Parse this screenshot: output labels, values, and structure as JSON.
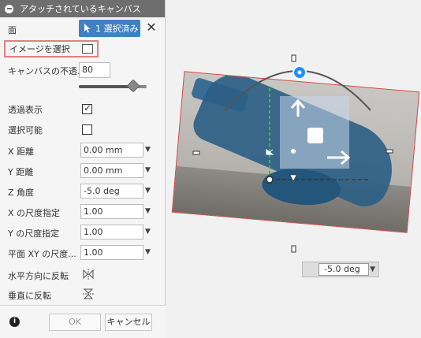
{
  "panel": {
    "title": "アタッチされているキャンバス",
    "face_label": "面",
    "selected_button_label": "1 選択済み",
    "clear_label": "✕",
    "select_image_label": "イメージを選択",
    "opacity_label": "キャンバスの不透...",
    "opacity_value": "80",
    "opacity_fraction": 0.8,
    "see_through_label": "透過表示",
    "see_through_checked": true,
    "selectable_label": "選択可能",
    "selectable_checked": false,
    "x_distance_label": "X 距離",
    "x_distance_value": "0.00 mm",
    "y_distance_label": "Y 距離",
    "y_distance_value": "0.00 mm",
    "z_angle_label": "Z 角度",
    "z_angle_value": "-5.0 deg",
    "x_scale_label": "X の尺度指定",
    "x_scale_value": "1.00",
    "y_scale_label": "Y の尺度指定",
    "y_scale_value": "1.00",
    "plane_xy_scale_label": "平面 XY の尺度...",
    "plane_xy_scale_value": "1.00",
    "flip_horizontal_label": "水平方向に反転",
    "flip_vertical_label": "垂直に反転",
    "ok_label": "OK",
    "cancel_label": "キャンセル"
  },
  "viewport": {
    "angle_readout": "-5.0 deg"
  },
  "colors": {
    "accent": "#3f82c4",
    "header": "#6e6e6e",
    "highlight_border": "#e28080",
    "canvas_border": "#d2443f",
    "manipulator": "#1e90ff",
    "axis_green": "#22cc22"
  },
  "icons": {
    "minimize": "minus-circle-icon",
    "cursor": "arrow-cursor-icon",
    "image": "image-icon",
    "info": "info-icon",
    "flip_horizontal": "flip-horizontal-icon",
    "flip_vertical": "flip-vertical-icon"
  }
}
